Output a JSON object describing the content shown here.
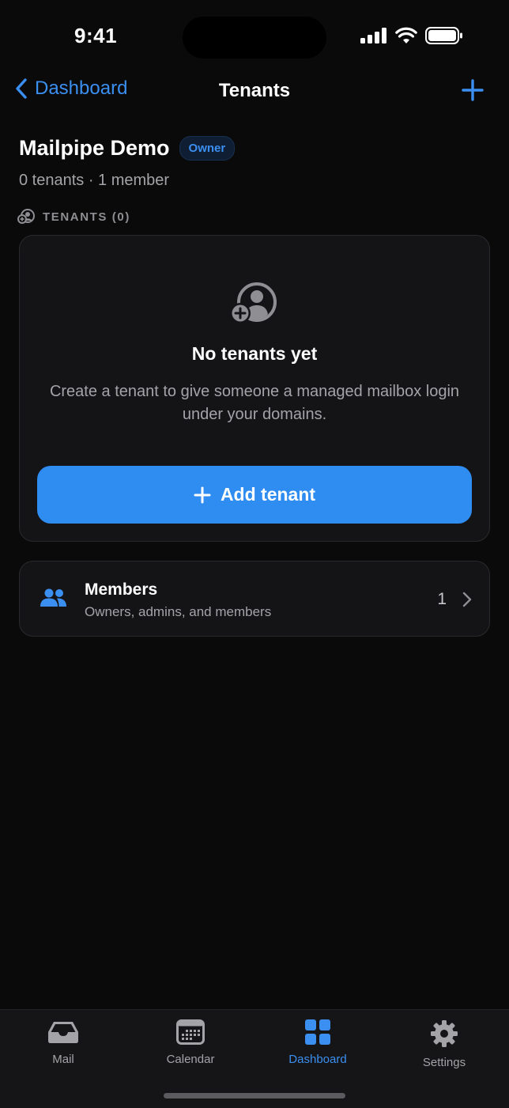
{
  "status": {
    "time": "9:41"
  },
  "nav": {
    "back_label": "Dashboard",
    "title": "Tenants"
  },
  "org": {
    "name": "Mailpipe Demo",
    "role_badge": "Owner",
    "summary": "0 tenants · 1 member"
  },
  "section": {
    "tenants_label": "TENANTS (0)"
  },
  "empty_state": {
    "title": "No tenants yet",
    "description": "Create a tenant to give someone a managed mailbox login under your domains.",
    "button_label": "Add tenant"
  },
  "members": {
    "title": "Members",
    "subtitle": "Owners, admins, and members",
    "count": "1"
  },
  "tabs": [
    {
      "label": "Mail",
      "icon": "inbox-tray-icon",
      "active": false
    },
    {
      "label": "Calendar",
      "icon": "calendar-icon",
      "active": false
    },
    {
      "label": "Dashboard",
      "icon": "grid-icon",
      "active": true
    },
    {
      "label": "Settings",
      "icon": "gear-icon",
      "active": false
    }
  ],
  "colors": {
    "accent": "#2f8cf0",
    "background": "#0a0a0a",
    "card": "#141416",
    "secondary_text": "#a4a4a8"
  }
}
